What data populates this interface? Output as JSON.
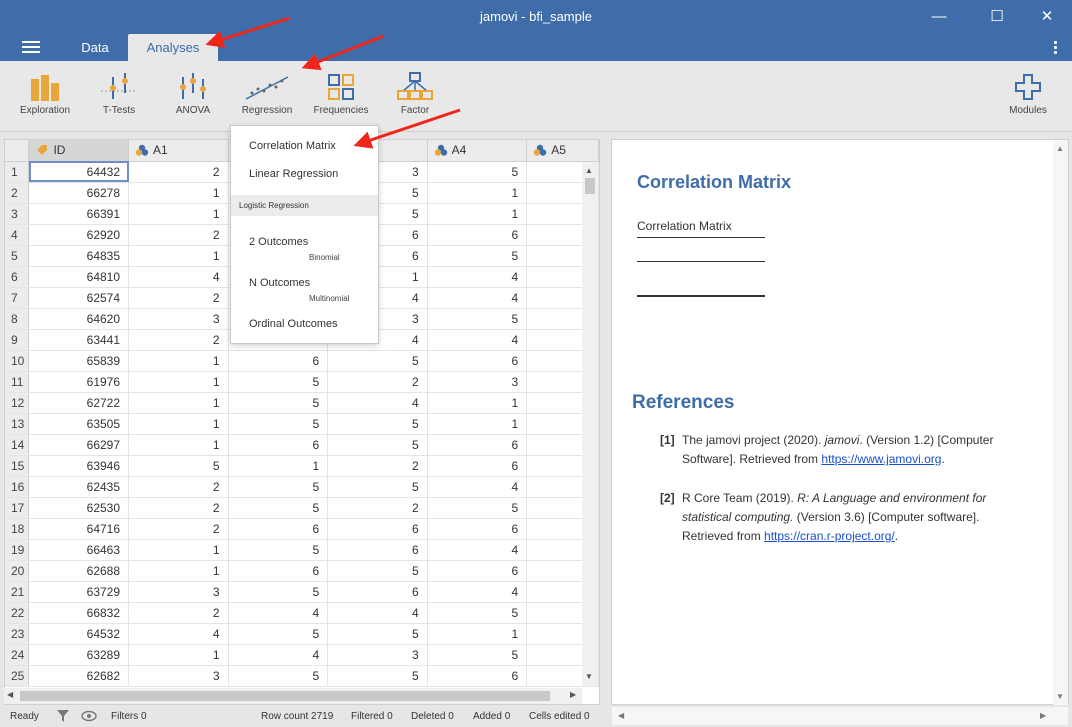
{
  "window": {
    "title": "jamovi - bfi_sample",
    "minimize_glyph": "—",
    "maximize_glyph": "☐",
    "close_glyph": "✕"
  },
  "tabs": [
    {
      "label": "Data"
    },
    {
      "label": "Analyses"
    }
  ],
  "ribbon": {
    "exploration": "Exploration",
    "ttests": "T-Tests",
    "anova": "ANOVA",
    "regression": "Regression",
    "frequencies": "Frequencies",
    "factor": "Factor",
    "modules": "Modules"
  },
  "grid": {
    "columns": [
      "ID",
      "A1",
      "A2",
      "A3",
      "A4",
      "A5"
    ],
    "rows": [
      {
        "n": "1",
        "id": "64432",
        "a1": "2",
        "a2": "",
        "a3": "3",
        "a4": "5"
      },
      {
        "n": "2",
        "id": "66278",
        "a1": "1",
        "a2": "",
        "a3": "5",
        "a4": "1"
      },
      {
        "n": "3",
        "id": "66391",
        "a1": "1",
        "a2": "",
        "a3": "5",
        "a4": "1"
      },
      {
        "n": "4",
        "id": "62920",
        "a1": "2",
        "a2": "",
        "a3": "6",
        "a4": "6"
      },
      {
        "n": "5",
        "id": "64835",
        "a1": "1",
        "a2": "",
        "a3": "6",
        "a4": "5"
      },
      {
        "n": "6",
        "id": "64810",
        "a1": "4",
        "a2": "",
        "a3": "1",
        "a4": "4"
      },
      {
        "n": "7",
        "id": "62574",
        "a1": "2",
        "a2": "",
        "a3": "4",
        "a4": "4"
      },
      {
        "n": "8",
        "id": "64620",
        "a1": "3",
        "a2": "",
        "a3": "3",
        "a4": "5"
      },
      {
        "n": "9",
        "id": "63441",
        "a1": "2",
        "a2": "",
        "a3": "4",
        "a4": "4"
      },
      {
        "n": "10",
        "id": "65839",
        "a1": "1",
        "a2": "6",
        "a3": "5",
        "a4": "6"
      },
      {
        "n": "11",
        "id": "61976",
        "a1": "1",
        "a2": "5",
        "a3": "2",
        "a4": "3"
      },
      {
        "n": "12",
        "id": "62722",
        "a1": "1",
        "a2": "5",
        "a3": "4",
        "a4": "1"
      },
      {
        "n": "13",
        "id": "63505",
        "a1": "1",
        "a2": "5",
        "a3": "5",
        "a4": "1"
      },
      {
        "n": "14",
        "id": "66297",
        "a1": "1",
        "a2": "6",
        "a3": "5",
        "a4": "6"
      },
      {
        "n": "15",
        "id": "63946",
        "a1": "5",
        "a2": "1",
        "a3": "2",
        "a4": "6"
      },
      {
        "n": "16",
        "id": "62435",
        "a1": "2",
        "a2": "5",
        "a3": "5",
        "a4": "4"
      },
      {
        "n": "17",
        "id": "62530",
        "a1": "2",
        "a2": "5",
        "a3": "2",
        "a4": "5"
      },
      {
        "n": "18",
        "id": "64716",
        "a1": "2",
        "a2": "6",
        "a3": "6",
        "a4": "6"
      },
      {
        "n": "19",
        "id": "66463",
        "a1": "1",
        "a2": "5",
        "a3": "6",
        "a4": "4"
      },
      {
        "n": "20",
        "id": "62688",
        "a1": "1",
        "a2": "6",
        "a3": "5",
        "a4": "6"
      },
      {
        "n": "21",
        "id": "63729",
        "a1": "3",
        "a2": "5",
        "a3": "6",
        "a4": "4"
      },
      {
        "n": "22",
        "id": "66832",
        "a1": "2",
        "a2": "4",
        "a3": "4",
        "a4": "5"
      },
      {
        "n": "23",
        "id": "64532",
        "a1": "4",
        "a2": "5",
        "a3": "5",
        "a4": "1"
      },
      {
        "n": "24",
        "id": "63289",
        "a1": "1",
        "a2": "4",
        "a3": "3",
        "a4": "5"
      },
      {
        "n": "25",
        "id": "62682",
        "a1": "3",
        "a2": "5",
        "a3": "5",
        "a4": "6"
      }
    ]
  },
  "dropdown": {
    "correlation_matrix": "Correlation Matrix",
    "linear_regression": "Linear Regression",
    "logistic_group": "Logistic Regression",
    "two_outcomes": "2 Outcomes",
    "binomial": "Binomial",
    "n_outcomes": "N Outcomes",
    "multinomial": "Multinomial",
    "ordinal_outcomes": "Ordinal Outcomes"
  },
  "results": {
    "heading": "Correlation Matrix",
    "table_title": "Correlation Matrix",
    "references_heading": "References",
    "ref1_num": "[1]",
    "ref1_pre": "The jamovi project (2020). ",
    "ref1_ital": "jamovi",
    "ref1_post": ". (Version 1.2) [Computer Software]. Retrieved from ",
    "ref1_link": "https://www.jamovi.org",
    "ref1_end": ".",
    "ref2_num": "[2]",
    "ref2_pre": "R Core Team (2019). ",
    "ref2_ital": "R: A Language and environment for statistical computing.",
    "ref2_post": " (Version 3.6) [Computer software]. Retrieved from ",
    "ref2_link": "https://cran.r-project.org/",
    "ref2_end": "."
  },
  "status": {
    "ready": "Ready",
    "filters": "Filters 0",
    "row_count": "Row count 2719",
    "filtered": "Filtered 0",
    "deleted": "Deleted 0",
    "added": "Added 0",
    "cells_edited": "Cells edited 0"
  },
  "colors": {
    "accent": "#3e6da9",
    "ribbon_icon": "#e8a63a",
    "arrow": "#f0261b"
  }
}
